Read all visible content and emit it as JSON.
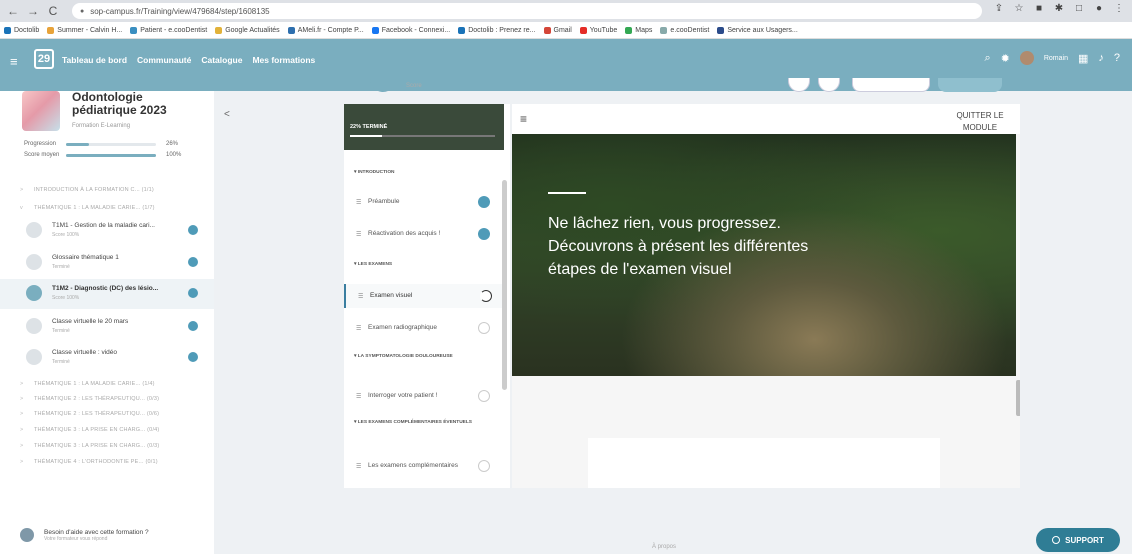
{
  "browser": {
    "url": "sop-campus.fr/Training/view/479684/step/1608135",
    "bookmarks": [
      "Doctolib",
      "Summer - Calvin H...",
      "Patient - e.cooDentist",
      "Google Actualités",
      "AMeli.fr - Compte P...",
      "Facebook - Connexi...",
      "Doctolib : Prenez re...",
      "Gmail",
      "YouTube",
      "Maps",
      "e.cooDentist",
      "Service aux Usagers..."
    ]
  },
  "header": {
    "nav": [
      "Tableau de bord",
      "Communauté",
      "Catalogue",
      "Mes formations"
    ],
    "user": "Romain"
  },
  "course": {
    "title": "Odontologie pédiatrique 2023",
    "subtitle": "Formation E-Learning",
    "progression_label": "Progression",
    "progression_value": "26%",
    "progression": 26,
    "score_label": "Score moyen",
    "score_value": "100%",
    "score": 100
  },
  "tree": [
    {
      "chev": ">",
      "label": "INTRODUCTION À LA FORMATION C...  (1/1)"
    },
    {
      "chev": "v",
      "label": "THÉMATIQUE 1 : LA MALADIE CARIE...  (1/7)"
    },
    {
      "chev": ">",
      "label": "THÉMATIQUE 1 : LA MALADIE CARIE...  (1/4)"
    },
    {
      "chev": ">",
      "label": "THÉMATIQUE 2 : LES THÉRAPEUTIQU...  (0/3)"
    },
    {
      "chev": ">",
      "label": "THÉMATIQUE 2 : LES THÉRAPEUTIQU...  (0/6)"
    },
    {
      "chev": ">",
      "label": "THÉMATIQUE 3 : LA PRISE EN CHARG...  (0/4)"
    },
    {
      "chev": ">",
      "label": "THÉMATIQUE 3 : LA PRISE EN CHARG...  (0/3)"
    },
    {
      "chev": ">",
      "label": "THÉMATIQUE 4 : L'ORTHODONTIE PE...  (0/1)"
    }
  ],
  "sub_items": [
    {
      "title": "T1M1 - Gestion de la maladie cari...",
      "status": "Score 100%"
    },
    {
      "title": "Glossaire thématique 1",
      "status": "Terminé"
    },
    {
      "title": "T1M2 - Diagnostic (DC) des lésio...",
      "status": "Score 100%"
    },
    {
      "title": "Classe virtuelle le 20 mars",
      "status": "Terminé"
    },
    {
      "title": "Classe virtuelle : vidéo",
      "status": "Terminé"
    }
  ],
  "help": {
    "title": "Besoin d'aide avec cette formation ?",
    "subtitle": "Votre formateur vous répond"
  },
  "score_label": "Score",
  "module": {
    "progress_label": "22% TERMINÉ",
    "progress": 22,
    "sections": [
      "INTRODUCTION",
      "LES EXAMENS",
      "LA SYMPTOMATOLOGIE DOULOUREUSE",
      "LES EXAMENS COMPLÉMENTAIRES ÉVENTUELS"
    ],
    "lessons": [
      "Préambule",
      "Réactivation des acquis !",
      "Examen visuel",
      "Examen radiographique",
      "Interroger votre patient !",
      "Les examens complémentaires"
    ]
  },
  "content": {
    "quit": "QUITTER LE MODULE",
    "hero_text": "Ne lâchez rien, vous progressez. Découvrons à présent les différentes étapes de l'examen visuel"
  },
  "footer": "À propos",
  "support": "SUPPORT"
}
